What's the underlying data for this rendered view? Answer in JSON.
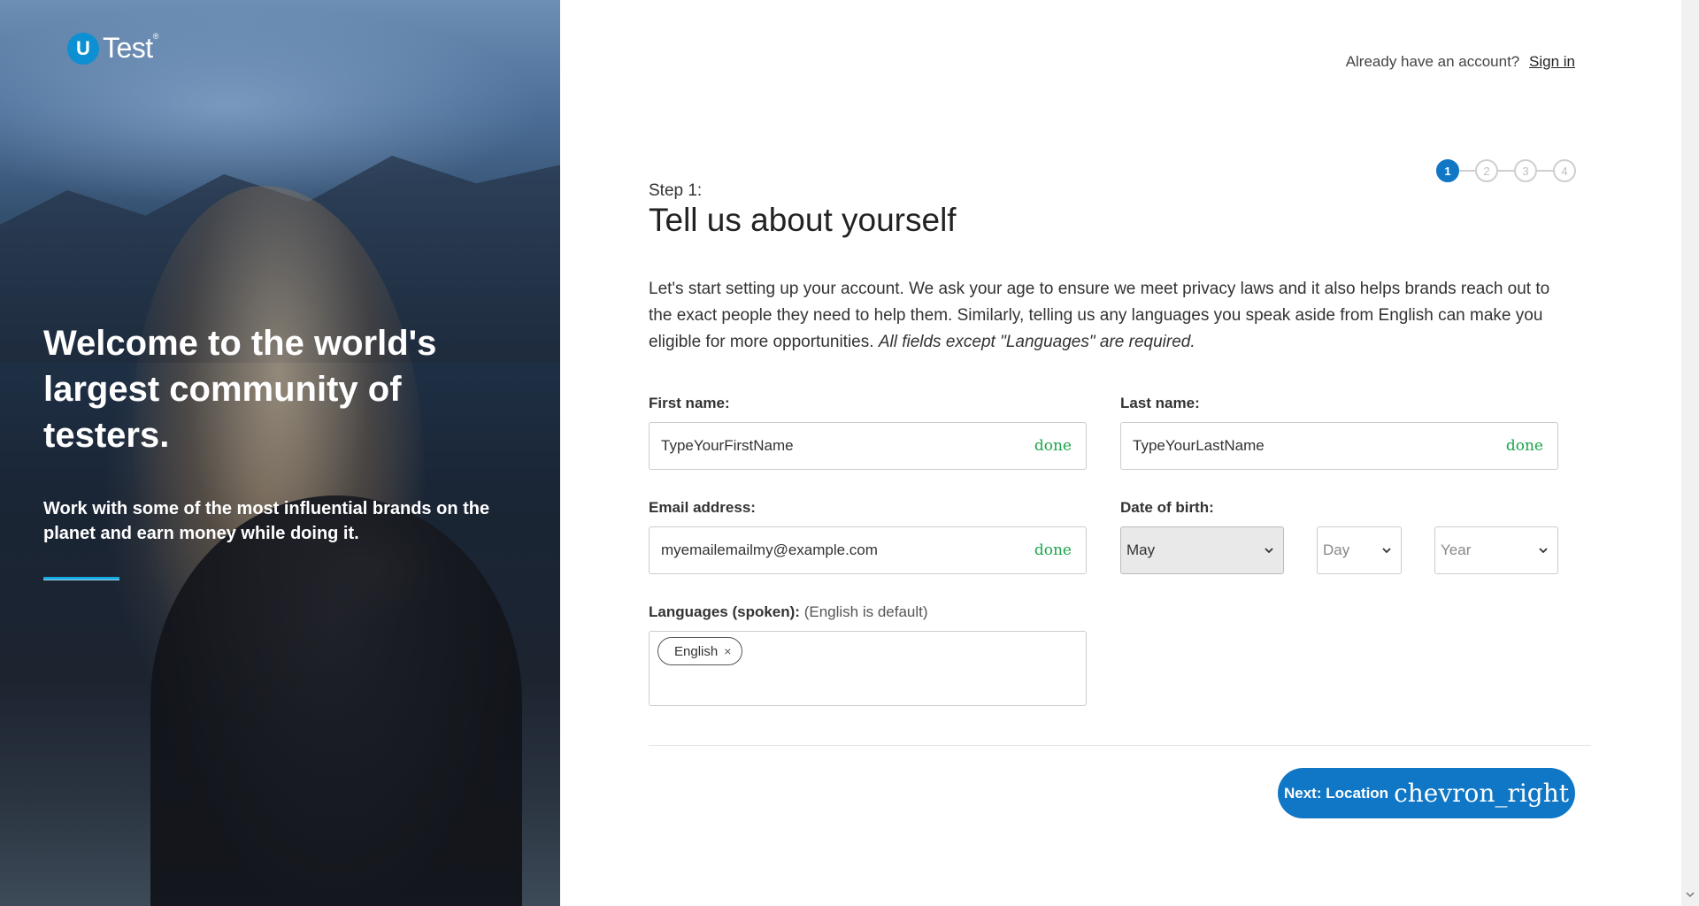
{
  "hero": {
    "logo_letter": "U",
    "logo_text": "Test",
    "logo_mark": "®",
    "title": "Welcome to the world's largest community of testers.",
    "subtitle": "Work with some of the most influential brands on the planet and earn money while doing it."
  },
  "header": {
    "already_text": "Already have an account?",
    "signin_label": "Sign in"
  },
  "stepper": {
    "steps": [
      "1",
      "2",
      "3",
      "4"
    ],
    "active": 1
  },
  "form": {
    "step_label": "Step 1:",
    "title": "Tell us about yourself",
    "intro_text": "Let's start setting up your account. We ask your age to ensure we meet privacy laws and it also helps brands reach out to the exact people they need to help them. Similarly, telling us any languages you speak aside from English can make you eligible for more opportunities. ",
    "intro_emphasis": "All fields except \"Languages\" are required.",
    "first_name": {
      "label": "First name:",
      "value": "TypeYourFirstName",
      "status": "done"
    },
    "last_name": {
      "label": "Last name:",
      "value": "TypeYourLastName",
      "status": "done"
    },
    "email": {
      "label": "Email address:",
      "value": "myemailemailmy@example.com",
      "status": "done"
    },
    "dob": {
      "label": "Date of birth:",
      "month": "May",
      "day_placeholder": "Day",
      "year_placeholder": "Year"
    },
    "languages": {
      "label": "Languages (spoken):",
      "note": "(English is default)",
      "tags": [
        "English"
      ],
      "remove_glyph": "×"
    },
    "next_button": {
      "label": "Next: Location",
      "icon_text": "chevron_right"
    }
  },
  "colors": {
    "primary": "#0f77c5",
    "done_green": "#1aa64a",
    "accent_line": "#18a9e0"
  }
}
